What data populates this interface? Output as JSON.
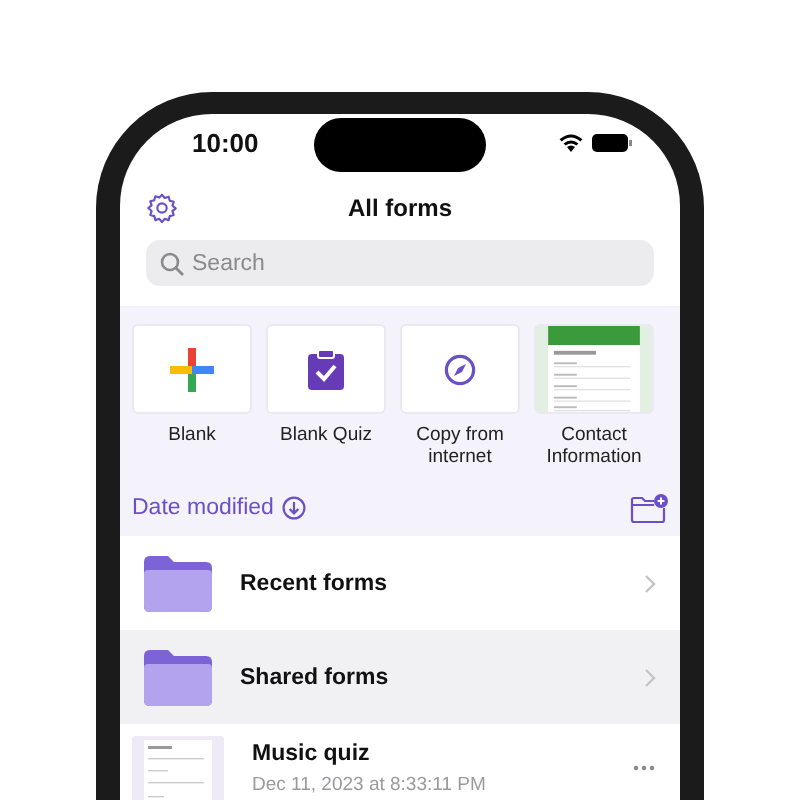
{
  "status_bar": {
    "time": "10:00"
  },
  "header": {
    "title": "All forms"
  },
  "search": {
    "placeholder": "Search"
  },
  "templates": [
    {
      "label": "Blank",
      "kind": "blank"
    },
    {
      "label": "Blank Quiz",
      "kind": "quiz"
    },
    {
      "label": "Copy from internet",
      "kind": "copy"
    },
    {
      "label": "Contact Information",
      "kind": "preview"
    }
  ],
  "sort": {
    "label": "Date modified"
  },
  "folders": [
    {
      "name": "Recent forms",
      "selected": false
    },
    {
      "name": "Shared forms",
      "selected": true
    }
  ],
  "forms": [
    {
      "title": "Music quiz",
      "date": "Dec 11, 2023 at 8:33:11 PM"
    }
  ]
}
